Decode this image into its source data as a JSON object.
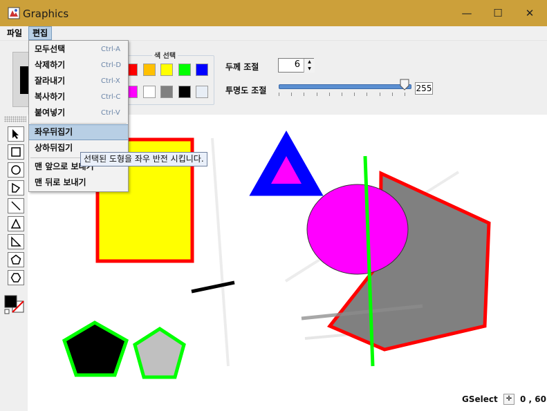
{
  "window": {
    "title": "Graphics",
    "controls": [
      "—",
      "☐",
      "✕"
    ]
  },
  "menubar": {
    "items": [
      "파일",
      "편집"
    ]
  },
  "edit_menu": {
    "items": [
      {
        "label": "모두선택",
        "shortcut": "Ctrl-A"
      },
      {
        "label": "삭제하기",
        "shortcut": "Ctrl-D"
      },
      {
        "label": "잘라내기",
        "shortcut": "Ctrl-X"
      },
      {
        "label": "복사하기",
        "shortcut": "Ctrl-C"
      },
      {
        "label": "붙여넣기",
        "shortcut": "Ctrl-V"
      },
      {
        "label": "좌우뒤집기",
        "shortcut": ""
      },
      {
        "label": "상하뒤집기",
        "shortcut": ""
      },
      {
        "label": "맨 앞으로 보내기",
        "shortcut": ""
      },
      {
        "label": "맨 뒤로 보내기",
        "shortcut": ""
      }
    ],
    "highlighted": "좌우뒤집기"
  },
  "tooltip": "선택된 도형을 좌우 반전 시킵니다.",
  "toolbar": {
    "color_group_label": "색 선택",
    "palette_row1": [
      "#ff0000",
      "#ffc000",
      "#ffff00",
      "#00ff00",
      "#0000ff"
    ],
    "palette_row2": [
      "#ff00ff",
      "#ffffff",
      "#808080",
      "#000000",
      "#e8eef6"
    ],
    "thickness_label": "두께 조절",
    "thickness_value": "6",
    "opacity_label": "투명도 조절",
    "opacity_value": "255",
    "opacity_fraction": 1.0
  },
  "tools": [
    "select-arrow",
    "rectangle",
    "oval",
    "polygon",
    "line",
    "triangle",
    "right-triangle",
    "pentagon",
    "hexagon"
  ],
  "status": {
    "mode": "GSelect",
    "coords": "0 , 60"
  },
  "colors": {
    "titlebar": "#cca03a",
    "menu_highlight": "#b8cfe5"
  }
}
